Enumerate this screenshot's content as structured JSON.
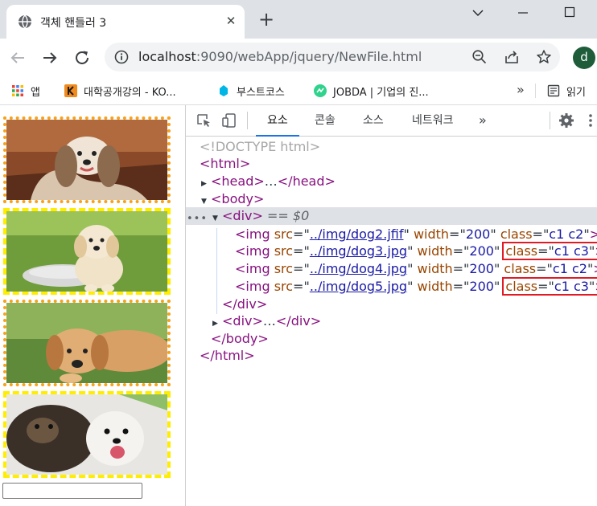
{
  "browser": {
    "tab_title": "객체 핸들러 3",
    "new_tab": "+",
    "url_host": "localhost",
    "url_path": ":9090/webApp/jquery/NewFile.html",
    "profile_initial": "d"
  },
  "bookmarks": {
    "items": [
      {
        "label": "앱",
        "icon": "apps-grid-icon"
      },
      {
        "label": "대학공개강의 - KO...",
        "icon": "kocw-icon"
      },
      {
        "label": "부스트코스",
        "icon": "boostcourse-icon"
      },
      {
        "label": "JOBDA | 기업의 진...",
        "icon": "jobda-icon"
      }
    ],
    "more": "»",
    "reading_list": "읽기"
  },
  "page": {
    "images": [
      {
        "name": "dog2",
        "classes": "c1 c2"
      },
      {
        "name": "dog3",
        "classes": "c1 c3"
      },
      {
        "name": "dog4",
        "classes": "c1 c2"
      },
      {
        "name": "dog5",
        "classes": "c1 c3"
      }
    ],
    "colors": {
      "c2_border": "#f7a21b",
      "c3_border": "#ffee00"
    }
  },
  "devtools": {
    "tabs": [
      "요소",
      "콘솔",
      "소스",
      "네트워크"
    ],
    "active_tab": "요소",
    "more_tabs": "»",
    "dom": {
      "doctype": "<!DOCTYPE html>",
      "html_open": "<html>",
      "head_tag_open": "<head>",
      "ellipsis": "…",
      "head_tag_close": "</head>",
      "body_open": "<body>",
      "div_open": "<div>",
      "selected_marker": "== $0",
      "img_lines": [
        {
          "src": "../img/dog2.jfif",
          "width": "200",
          "class": "c1 c2",
          "highlighted": false
        },
        {
          "src": "../img/dog3.jpg",
          "width": "200",
          "class": "c1 c3",
          "highlighted": true
        },
        {
          "src": "../img/dog4.jpg",
          "width": "200",
          "class": "c1 c2",
          "highlighted": false
        },
        {
          "src": "../img/dog5.jpg",
          "width": "200",
          "class": "c1 c3",
          "highlighted": true
        }
      ],
      "div_close": "</div>",
      "div2_open": "<div>",
      "div2_close": "</div>",
      "body_close": "</body>",
      "html_close": "</html>"
    }
  }
}
